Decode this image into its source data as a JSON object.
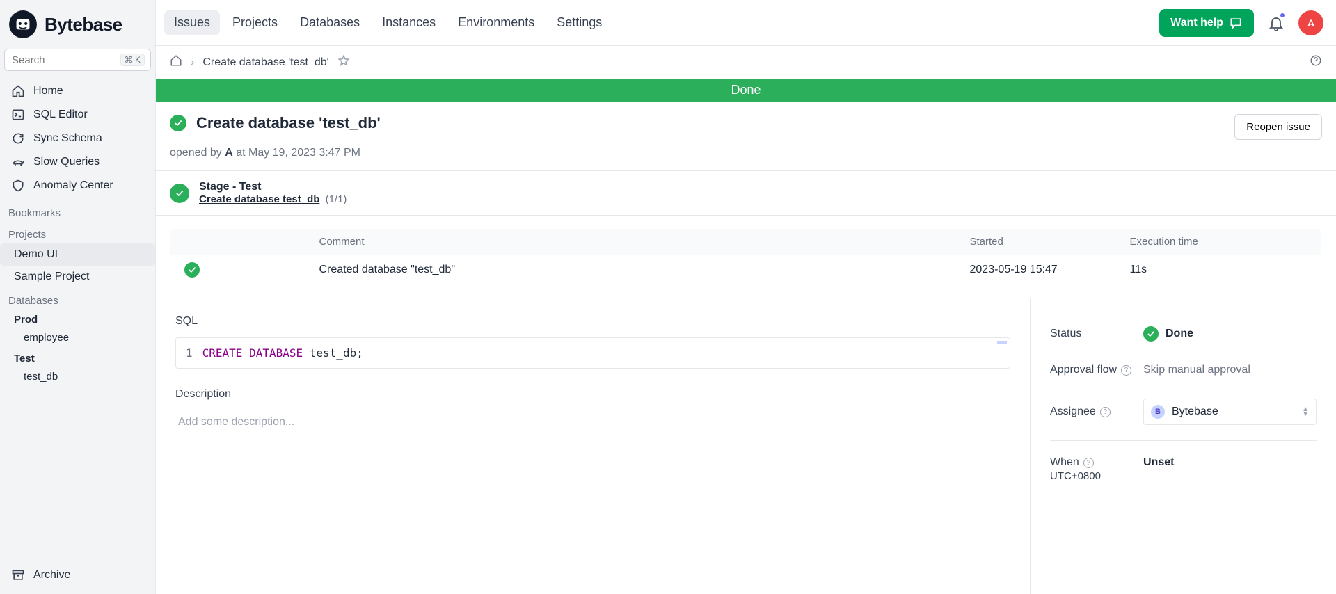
{
  "brand": "Bytebase",
  "search": {
    "placeholder": "Search",
    "shortcut": "⌘  K"
  },
  "sidebar": {
    "nav": [
      {
        "label": "Home"
      },
      {
        "label": "SQL Editor"
      },
      {
        "label": "Sync Schema"
      },
      {
        "label": "Slow Queries"
      },
      {
        "label": "Anomaly Center"
      }
    ],
    "sections": {
      "bookmarks": "Bookmarks",
      "projects": "Projects",
      "databases": "Databases"
    },
    "projects": [
      {
        "label": "Demo UI",
        "active": true
      },
      {
        "label": "Sample Project",
        "active": false
      }
    ],
    "databases": [
      {
        "env": "Prod",
        "items": [
          {
            "label": "employee"
          }
        ]
      },
      {
        "env": "Test",
        "items": [
          {
            "label": "test_db"
          }
        ]
      }
    ],
    "archive": "Archive"
  },
  "topnav": {
    "tabs": [
      "Issues",
      "Projects",
      "Databases",
      "Instances",
      "Environments",
      "Settings"
    ],
    "activeIndex": 0,
    "help": "Want help",
    "avatarInitial": "A"
  },
  "breadcrumb": {
    "title": "Create database 'test_db'"
  },
  "banner": "Done",
  "issue": {
    "title": "Create database 'test_db'",
    "opened_by_prefix": "opened by ",
    "opened_by_user": "A",
    "opened_at": " at May 19, 2023 3:47 PM",
    "reopen": "Reopen issue"
  },
  "stage": {
    "name": "Stage - Test",
    "task": "Create database test_db",
    "count": "(1/1)"
  },
  "table": {
    "headers": [
      "",
      "Comment",
      "Started",
      "Execution time"
    ],
    "rows": [
      {
        "comment": "Created database \"test_db\"",
        "started": "2023-05-19 15:47",
        "exec": "11s"
      }
    ]
  },
  "sql": {
    "label": "SQL",
    "line_no": "1",
    "kw": "CREATE DATABASE",
    "rest": " test_db;"
  },
  "description": {
    "label": "Description",
    "placeholder": "Add some description..."
  },
  "meta": {
    "status_label": "Status",
    "status_value": "Done",
    "approval_label": "Approval flow",
    "approval_value": "Skip manual approval",
    "assignee_label": "Assignee",
    "assignee_initial": "B",
    "assignee_value": "Bytebase",
    "when_label": "When",
    "when_tz": "UTC+0800",
    "when_value": "Unset"
  }
}
